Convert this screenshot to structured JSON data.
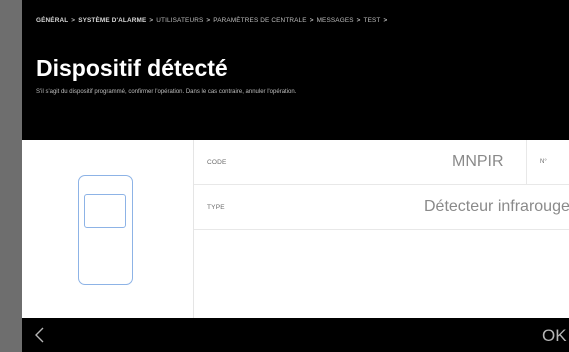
{
  "breadcrumb": {
    "items": [
      "GÉNÉRAL",
      "SYSTÈME D'ALARME",
      "UTILISATEURS",
      "PARAMÈTRES DE CENTRALE",
      "MESSAGES",
      "TEST"
    ],
    "separator": ">"
  },
  "header": {
    "title": "Dispositif détecté",
    "subtitle": "S'il s'agit du dispositif programmé, confirmer l'opération. Dans le cas contraire, annuler l'opération."
  },
  "fields": {
    "code_label": "CODE",
    "code_value": "MNPIR",
    "no_label": "N°",
    "type_label": "TYPE",
    "type_value": "Détecteur infrarouge"
  },
  "footer": {
    "back_icon": "chevron-left-icon",
    "ok_label": "OK"
  },
  "colors": {
    "background": "#000000",
    "panel": "#ffffff",
    "device_outline": "#8db3e6",
    "frame_border": "#6e6e6e"
  }
}
